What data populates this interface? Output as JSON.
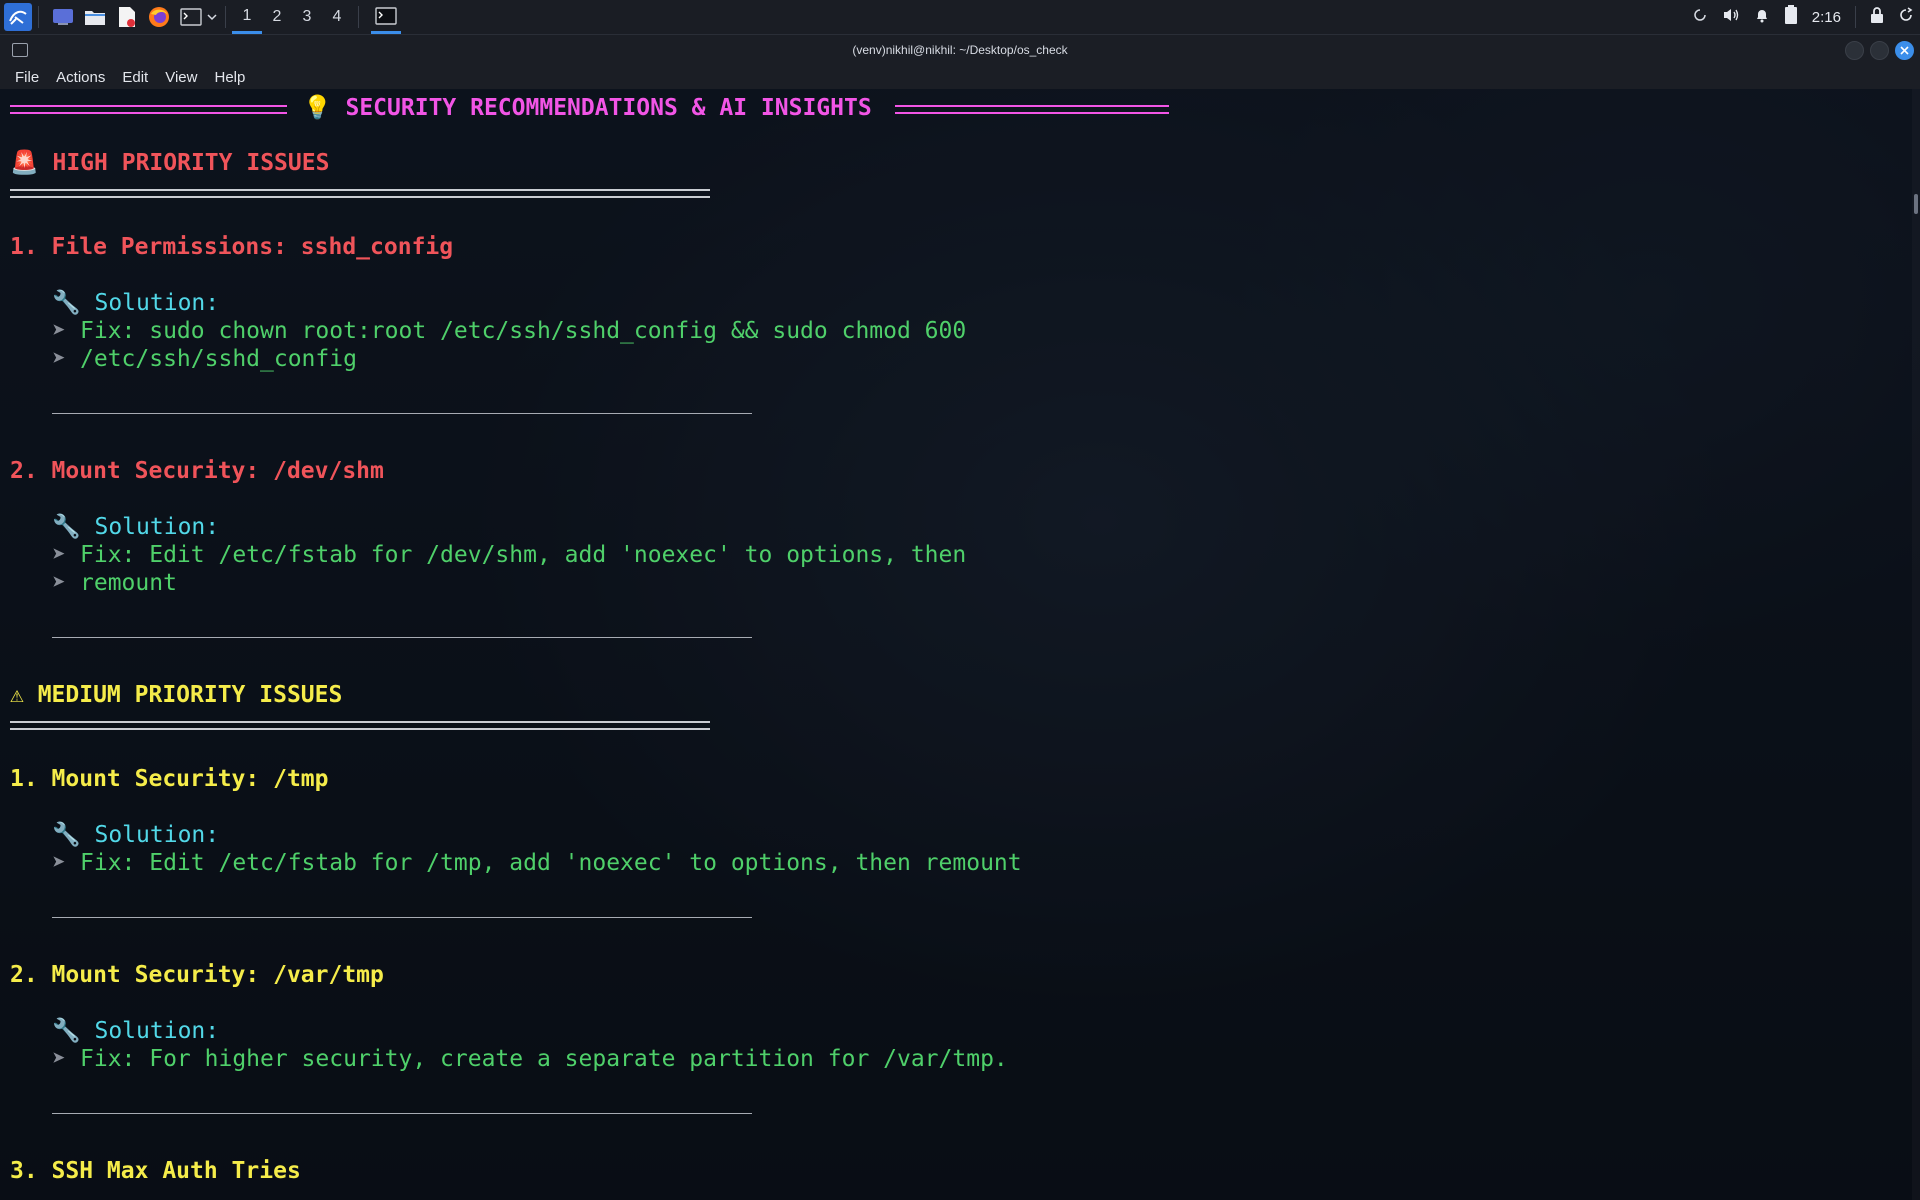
{
  "taskbar": {
    "workspaces": [
      "1",
      "2",
      "3",
      "4"
    ],
    "clock": "2:16",
    "icons": [
      "kali-menu-icon",
      "desktop-icon",
      "files-icon",
      "text-editor-icon",
      "firefox-icon",
      "terminal-icon",
      "chevron-down-icon"
    ],
    "tray_icons": [
      "refresh-icon",
      "volume-icon",
      "bell-icon",
      "battery-icon",
      "lock-icon",
      "power-icon"
    ]
  },
  "window": {
    "title": "(venv)nikhil@nikhil: ~/Desktop/os_check",
    "menu": [
      "File",
      "Actions",
      "Edit",
      "View",
      "Help"
    ]
  },
  "terminal": {
    "header": "💡 SECURITY RECOMMENDATIONS & AI INSIGHTS",
    "high": {
      "heading": "🚨 HIGH PRIORITY ISSUES",
      "items": [
        {
          "title": "1. File Permissions: sshd_config",
          "solution_label": "🔧 Solution:",
          "lines": [
            "Fix: sudo chown root:root /etc/ssh/sshd_config && sudo chmod 600",
            "/etc/ssh/sshd_config"
          ]
        },
        {
          "title": "2. Mount Security: /dev/shm",
          "solution_label": "🔧 Solution:",
          "lines": [
            "Fix: Edit /etc/fstab for /dev/shm, add 'noexec' to options, then",
            "remount"
          ]
        }
      ]
    },
    "medium": {
      "heading": "⚠ MEDIUM PRIORITY ISSUES",
      "items": [
        {
          "title": "1. Mount Security: /tmp",
          "solution_label": "🔧 Solution:",
          "lines": [
            "Fix: Edit /etc/fstab for /tmp, add 'noexec' to options, then remount"
          ]
        },
        {
          "title": "2. Mount Security: /var/tmp",
          "solution_label": "🔧 Solution:",
          "lines": [
            "Fix: For higher security, create a separate partition for /var/tmp."
          ]
        },
        {
          "title": "3. SSH Max Auth Tries"
        }
      ]
    },
    "bullet": "➤"
  }
}
